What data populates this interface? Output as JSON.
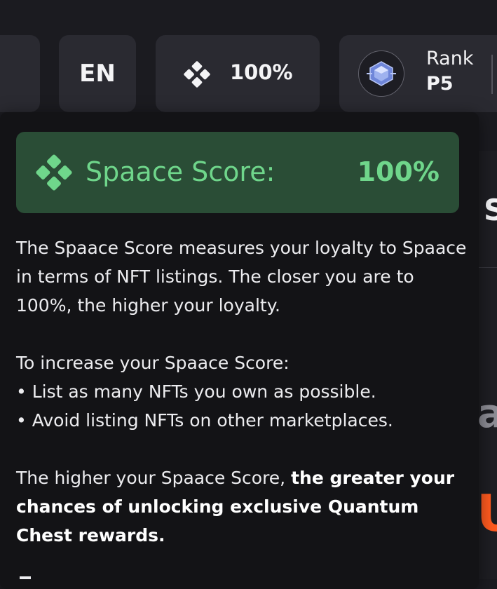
{
  "header": {
    "language": "EN",
    "score_value": "100%",
    "rank_label": "Rank",
    "rank_value": "P5"
  },
  "popover": {
    "title": "Spaace Score:",
    "score": "100%",
    "intro": "The Spaace Score measures your loyalty to Spaace in terms of NFT listings. The closer you are to 100%, the higher your loyalty.",
    "tips_heading": "To increase your Spaace Score:",
    "tips": [
      "• List as many NFTs you own as possible.",
      "• Avoid listing NFTs on other marketplaces."
    ],
    "outro_prefix": "The higher your Spaace Score, ",
    "outro_bold": "the greater your chances of unlocking exclusive Quantum Chest rewards."
  },
  "background": {
    "fragment_s": "S",
    "fragment_a": "a",
    "fragment_u": "U"
  },
  "colors": {
    "accent_green": "#6fd68b",
    "banner_green": "#2a4d36",
    "accent_orange": "#ff5a1f"
  },
  "icons": {
    "score": "diamond-cluster-icon",
    "rank": "gem-badge-icon"
  }
}
